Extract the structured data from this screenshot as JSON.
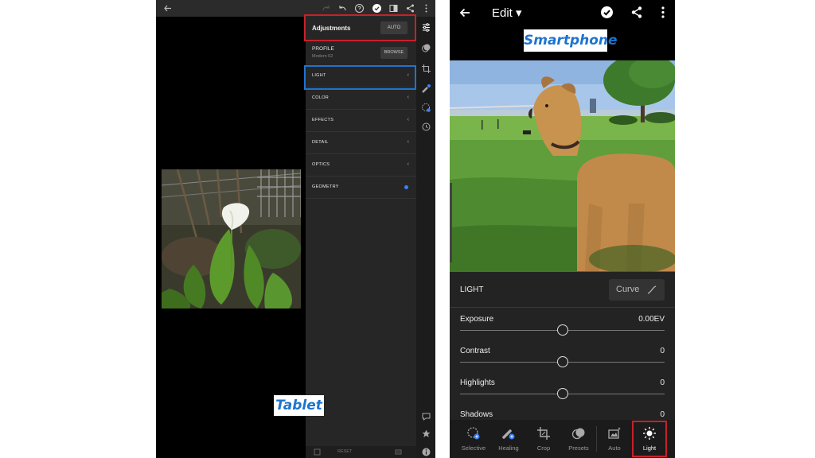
{
  "tablet": {
    "tag": "Tablet",
    "panel": {
      "title": "Adjustments",
      "auto_label": "AUTO",
      "profile_label": "PROFILE",
      "profile_value": "Modern 02",
      "browse_label": "BROWSE",
      "sections": [
        {
          "label": "LIGHT",
          "indicator": "chevron"
        },
        {
          "label": "COLOR",
          "indicator": "chevron"
        },
        {
          "label": "EFFECTS",
          "indicator": "chevron"
        },
        {
          "label": "DETAIL",
          "indicator": "chevron"
        },
        {
          "label": "OPTICS",
          "indicator": "chevron"
        },
        {
          "label": "GEOMETRY",
          "indicator": "dot"
        }
      ],
      "reset_label": "RESET",
      "chevron_glyph": "‹"
    },
    "icons": [
      "back-arrow-icon",
      "redo-icon",
      "undo-icon",
      "help-icon",
      "done-check-icon",
      "compare-icon",
      "share-icon",
      "more-icon"
    ],
    "rail_icons": [
      "adjustments-icon",
      "presets-icon",
      "crop-icon",
      "healing-icon",
      "selective-icon",
      "history-icon",
      "comment-icon",
      "star-icon",
      "info-icon"
    ],
    "highlight_colors": {
      "red": "#c8202a",
      "blue": "#1e73d1"
    }
  },
  "phone": {
    "tag": "Smartphone",
    "header": {
      "title": "Edit ▾"
    },
    "light": {
      "label": "LIGHT",
      "curve_label": "Curve",
      "sliders": [
        {
          "name": "Exposure",
          "value": "0.00EV",
          "position": 0.5
        },
        {
          "name": "Contrast",
          "value": "0",
          "position": 0.5
        },
        {
          "name": "Highlights",
          "value": "0",
          "position": 0.5
        },
        {
          "name": "Shadows",
          "value": "0",
          "position": 0.5
        }
      ]
    },
    "tools": [
      {
        "label": "Selective",
        "icon": "selective-icon",
        "active": false
      },
      {
        "label": "Healing",
        "icon": "healing-icon",
        "active": false
      },
      {
        "label": "Crop",
        "icon": "crop-icon",
        "active": false
      },
      {
        "label": "Presets",
        "icon": "presets-icon",
        "active": false
      },
      {
        "label": "Auto",
        "icon": "auto-icon",
        "active": false
      },
      {
        "label": "Light",
        "icon": "light-icon",
        "active": true
      }
    ],
    "accent_color": "#1e73d1"
  }
}
